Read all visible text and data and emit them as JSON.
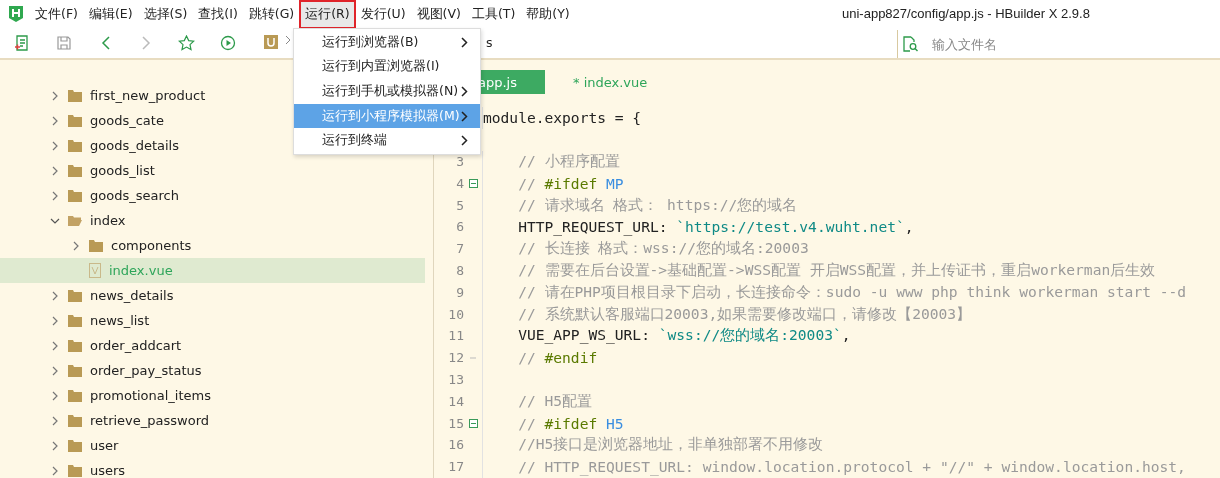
{
  "window": {
    "title": "uni-app827/config/app.js - HBuilder X 2.9.8"
  },
  "menu_bar": [
    {
      "label": "文件(F)",
      "selected": false
    },
    {
      "label": "编辑(E)",
      "selected": false
    },
    {
      "label": "选择(S)",
      "selected": false
    },
    {
      "label": "查找(I)",
      "selected": false
    },
    {
      "label": "跳转(G)",
      "selected": false
    },
    {
      "label": "运行(R)",
      "selected": true
    },
    {
      "label": "发行(U)",
      "selected": false
    },
    {
      "label": "视图(V)",
      "selected": false
    },
    {
      "label": "工具(T)",
      "selected": false
    },
    {
      "label": "帮助(Y)",
      "selected": false
    }
  ],
  "run_menu": [
    {
      "label": "运行到浏览器(B)",
      "submenu": true,
      "selected": false
    },
    {
      "label": "运行到内置浏览器(I)",
      "submenu": false,
      "selected": false
    },
    {
      "label": "运行到手机或模拟器(N)",
      "submenu": true,
      "selected": false
    },
    {
      "label": "运行到小程序模拟器(M)",
      "submenu": true,
      "selected": true
    },
    {
      "label": "运行到终端",
      "submenu": true,
      "selected": false
    }
  ],
  "toolbar": {
    "breadcrumb_tail": "s",
    "file_search": {
      "placeholder": "输入文件名"
    }
  },
  "project_tree": [
    {
      "name": "first_new_product",
      "kind": "folder",
      "expanded": false,
      "selected": false
    },
    {
      "name": "goods_cate",
      "kind": "folder",
      "expanded": false,
      "selected": false
    },
    {
      "name": "goods_details",
      "kind": "folder",
      "expanded": false,
      "selected": false
    },
    {
      "name": "goods_list",
      "kind": "folder",
      "expanded": false,
      "selected": false
    },
    {
      "name": "goods_search",
      "kind": "folder",
      "expanded": false,
      "selected": false
    },
    {
      "name": "index",
      "kind": "folder",
      "expanded": true,
      "selected": false,
      "children": [
        {
          "name": "components",
          "kind": "folder",
          "expanded": false,
          "selected": false
        },
        {
          "name": "index.vue",
          "kind": "file",
          "selected": true
        }
      ]
    },
    {
      "name": "news_details",
      "kind": "folder",
      "expanded": false,
      "selected": false
    },
    {
      "name": "news_list",
      "kind": "folder",
      "expanded": false,
      "selected": false
    },
    {
      "name": "order_addcart",
      "kind": "folder",
      "expanded": false,
      "selected": false
    },
    {
      "name": "order_pay_status",
      "kind": "folder",
      "expanded": false,
      "selected": false
    },
    {
      "name": "promotional_items",
      "kind": "folder",
      "expanded": false,
      "selected": false
    },
    {
      "name": "retrieve_password",
      "kind": "folder",
      "expanded": false,
      "selected": false
    },
    {
      "name": "user",
      "kind": "folder",
      "expanded": false,
      "selected": false
    },
    {
      "name": "users",
      "kind": "folder",
      "expanded": false,
      "selected": false
    }
  ],
  "editor_tabs": [
    {
      "label": "app.js",
      "selected": true
    },
    {
      "label": "* index.vue",
      "selected": false
    }
  ],
  "code_lines": [
    {
      "tokens": [
        {
          "kind": "plain",
          "text": "module.exports = {"
        }
      ]
    },
    {
      "kind": "blank"
    },
    {
      "num": "3",
      "tokens": [
        {
          "kind": "comment",
          "text": "    // 小程序配置"
        }
      ]
    },
    {
      "num": "4",
      "foldable": true,
      "tokens": [
        {
          "kind": "comment",
          "text": "    // "
        },
        {
          "kind": "directive",
          "text": "#ifdef "
        },
        {
          "kind": "macro",
          "text": "MP"
        }
      ]
    },
    {
      "num": "5",
      "tokens": [
        {
          "kind": "comment",
          "text": "    // 请求域名 格式： https://您的域名"
        }
      ]
    },
    {
      "num": "6",
      "tokens": [
        {
          "kind": "plain",
          "text": "    HTTP_REQUEST_URL: "
        },
        {
          "kind": "string",
          "text": "`https://test.v4.wuht.net`"
        },
        {
          "kind": "plain",
          "text": ","
        }
      ]
    },
    {
      "num": "7",
      "tokens": [
        {
          "kind": "comment",
          "text": "    // 长连接 格式：wss://您的域名:20003"
        }
      ]
    },
    {
      "num": "8",
      "tokens": [
        {
          "kind": "comment",
          "text": "    // 需要在后台设置->基础配置->WSS配置 开启WSS配置，并上传证书，重启workerman后生效"
        }
      ]
    },
    {
      "num": "9",
      "tokens": [
        {
          "kind": "comment",
          "text": "    // 请在PHP项目根目录下启动，长连接命令：sudo -u www php think workerman start --d"
        }
      ]
    },
    {
      "num": "10",
      "tokens": [
        {
          "kind": "comment",
          "text": "    // 系统默认客服端口20003,如果需要修改端口，请修改【20003】"
        }
      ]
    },
    {
      "num": "11",
      "tokens": [
        {
          "kind": "plain",
          "text": "    VUE_APP_WS_URL: "
        },
        {
          "kind": "string",
          "text": "`wss://您的域名:20003`"
        },
        {
          "kind": "plain",
          "text": ","
        }
      ]
    },
    {
      "num": "12",
      "fold_end": true,
      "tokens": [
        {
          "kind": "comment",
          "text": "    // "
        },
        {
          "kind": "directive",
          "text": "#endif"
        }
      ]
    },
    {
      "num": "13"
    },
    {
      "num": "14",
      "tokens": [
        {
          "kind": "comment",
          "text": "    // H5配置"
        }
      ]
    },
    {
      "num": "15",
      "foldable": true,
      "tokens": [
        {
          "kind": "comment",
          "text": "    // "
        },
        {
          "kind": "directive",
          "text": "#ifdef "
        },
        {
          "kind": "macro",
          "text": "H5"
        }
      ]
    },
    {
      "num": "16",
      "tokens": [
        {
          "kind": "comment",
          "text": "    //H5接口是浏览器地址，非单独部署不用修改"
        }
      ]
    },
    {
      "num": "17",
      "tokens": [
        {
          "kind": "comment",
          "text": "    // HTTP_REQUEST_URL: window.location.protocol + \"//\" + window.location.host,"
        }
      ]
    }
  ]
}
